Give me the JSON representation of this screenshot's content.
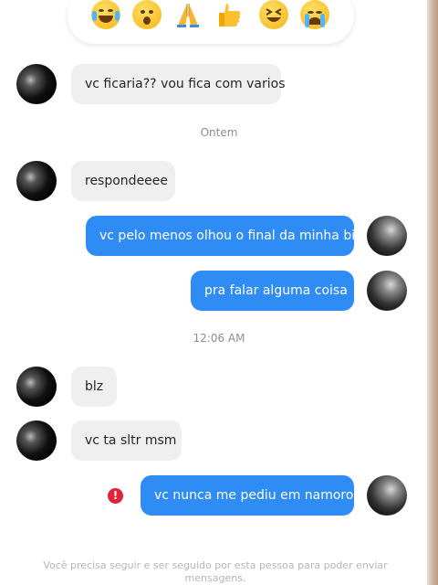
{
  "reactions": {
    "icons": [
      "laughing-tears-icon",
      "surprised-face-icon",
      "folded-hands-icon",
      "thumbs-up-icon",
      "grinning-squint-icon",
      "crying-face-icon"
    ]
  },
  "messages": [
    {
      "text": "vc ficaria?? vou fica com varios"
    },
    {
      "text": "respondeeee"
    },
    {
      "text": "vc pelo menos olhou o final da minha bio"
    },
    {
      "text": "pra falar alguma coisa"
    },
    {
      "text": "blz"
    },
    {
      "text": "vc ta sltr msm"
    },
    {
      "text": "vc nunca me pediu em namoro"
    }
  ],
  "timestamps": {
    "yesterday": "Ontem",
    "time": "12:06 AM"
  },
  "error_mark": "!",
  "footer": "Você precisa seguir e ser seguido por esta pessoa para poder enviar mensagens.",
  "colors": {
    "outgoing": "#2f8cf5",
    "incoming": "#efefef",
    "error": "#e0243a"
  }
}
